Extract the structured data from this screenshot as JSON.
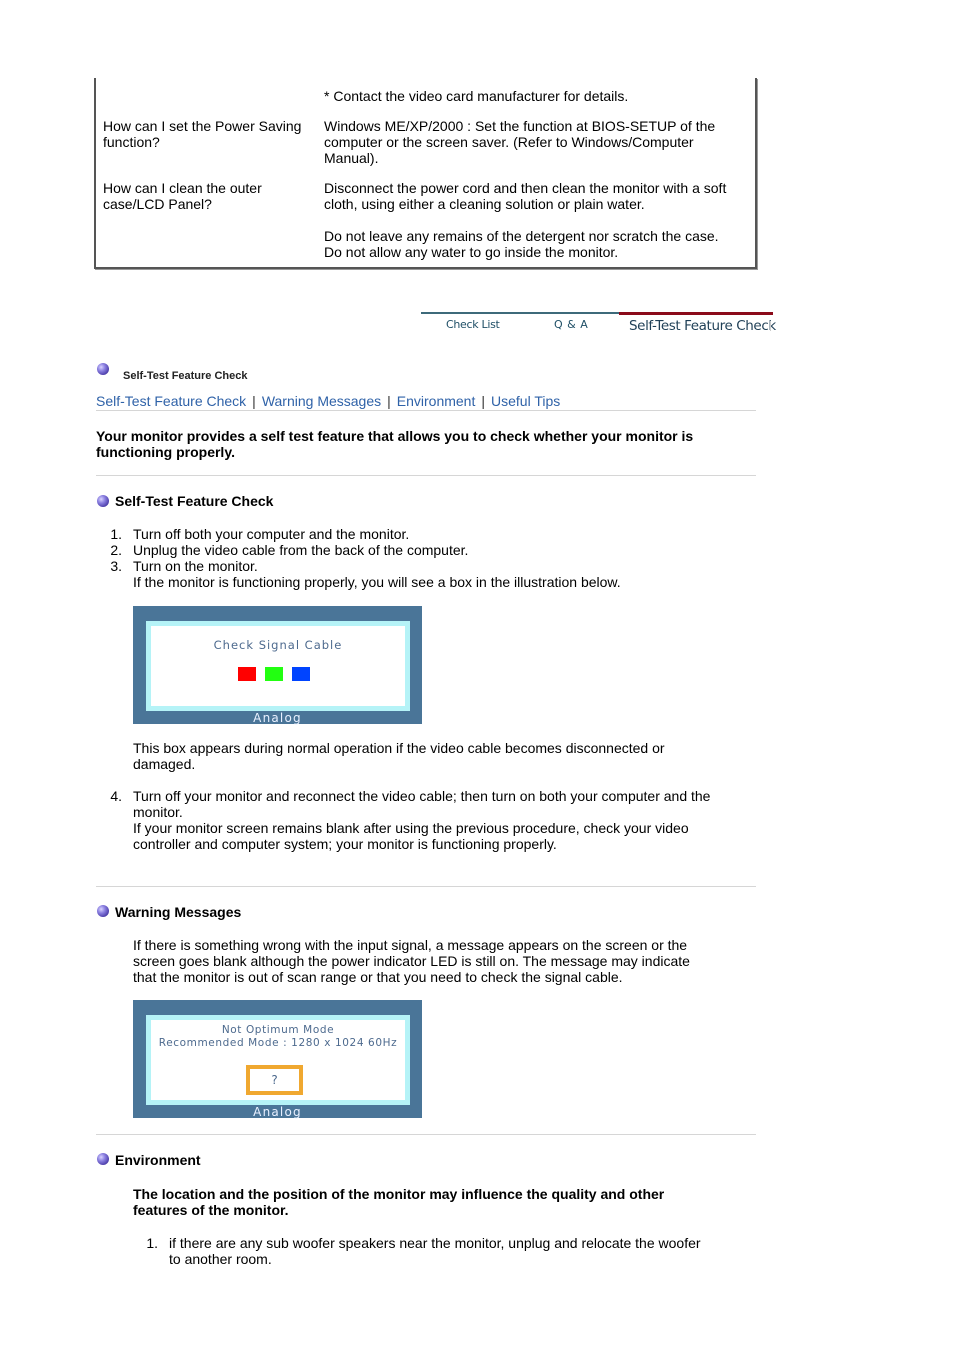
{
  "faq": {
    "rows": [
      {
        "question": "",
        "answer": [
          "* Contact the video card manufacturer for details."
        ]
      },
      {
        "question": "How can I set the Power Saving function?",
        "answer": [
          "Windows ME/XP/2000 : Set the function at BIOS-SETUP of the computer or the screen saver. (Refer to Windows/Computer Manual)."
        ]
      },
      {
        "question": "How can I clean the outer case/LCD Panel?",
        "answer": [
          "Disconnect the power cord and then clean the monitor with a soft cloth, using either a cleaning solution or plain water.",
          "Do not leave any remains of the detergent nor scratch the case. Do not allow any water to go inside the monitor."
        ]
      }
    ],
    "q_power_line1": "How can I set the Power Saving",
    "q_power_line2": "function?",
    "a_power_line1": "Windows ME/XP/2000 : Set the function at BIOS-SETUP of the",
    "a_power_line2": "computer or the screen saver. (Refer to Windows/Computer",
    "a_power_line3": "Manual).",
    "q_clean_line1": "How can I clean the outer",
    "q_clean_line2": "case/LCD Panel?",
    "a_clean_line1": "Disconnect the power cord and then clean the monitor with a soft",
    "a_clean_line2": "cloth, using either a cleaning solution or plain water.",
    "a_clean_line3": "Do not leave any remains of the detergent nor scratch the case.",
    "a_clean_line4": "Do not allow any water to go inside the monitor.",
    "a_contact": "* Contact the video card manufacturer for details."
  },
  "tabs": {
    "items": [
      "Check List",
      "Q & A",
      "Self-Test Feature Check"
    ],
    "active": "Self-Test Feature Check",
    "colors": {
      "active_bar": "#8b0a1a",
      "inactive_bar": "#3d6a7a"
    }
  },
  "page": {
    "section_title": "Self-Test Feature Check",
    "nav_links": [
      "Self-Test Feature Check",
      "Warning Messages",
      "Environment",
      "Useful Tips"
    ],
    "nav_separator": "|",
    "intro_line1": "Your monitor provides a self test feature that allows you to check whether your monitor is",
    "intro_line2": "functioning properly."
  },
  "self_test": {
    "heading": "Self-Test Feature Check",
    "steps": [
      {
        "num": "1.",
        "text": "Turn off both your computer and the monitor."
      },
      {
        "num": "2.",
        "text": "Unplug the video cable from the back of the computer."
      },
      {
        "num": "3.",
        "text": "Turn on the monitor."
      },
      {
        "num": "4.",
        "text": "Turn off your monitor and reconnect the video cable; then turn on both your computer and the"
      }
    ],
    "step3_note": "If the monitor is functioning properly, you will see a box in the illustration below.",
    "osd": {
      "message": "Check Signal Cable",
      "label": "Analog",
      "squares": [
        "#ff0000",
        "#22ff11",
        "#0044ff"
      ]
    },
    "after_osd_line1": "This box appears during normal operation if the video cable becomes disconnected or",
    "after_osd_line2": "damaged.",
    "step4_line2": "monitor.",
    "step4_note_line1": "If your monitor screen remains blank after using the previous procedure, check your video",
    "step4_note_line2": "controller and computer system; your monitor is functioning properly."
  },
  "warning": {
    "heading": "Warning Messages",
    "para_line1": "If there is something wrong with the input signal, a message appears on the screen or the",
    "para_line2": "screen goes blank although the power indicator LED is still on. The message may indicate",
    "para_line3": "that the monitor is out of scan range or that you need to check the signal cable.",
    "osd": {
      "line1": "Not Optimum Mode",
      "line2": "Recommended Mode : 1280 x 1024  60Hz",
      "button": "?",
      "label": "Analog"
    }
  },
  "environment": {
    "heading": "Environment",
    "intro_line1": "The location and the position of the monitor may influence the quality and other",
    "intro_line2": "features of the monitor.",
    "items": [
      {
        "num": "1.",
        "line1": "if there are any sub woofer speakers near the monitor, unplug and relocate the woofer",
        "line2": "to another room."
      }
    ]
  }
}
